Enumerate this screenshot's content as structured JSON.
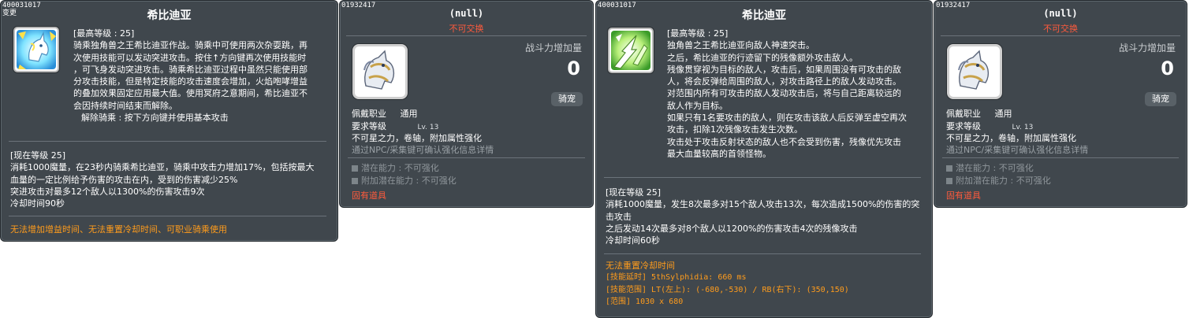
{
  "panels": {
    "skill1": {
      "id": "400031017",
      "sub": "变更",
      "title": "希比迪亚",
      "desc": [
        "[最高等级 : 25]",
        "骑乘独角兽之王希比迪亚作战。骑乘中可使用两次杂耍跳，再",
        "次使用技能可以发动突进攻击。按住↑方向键再次使用技能时",
        "，可飞身发动突进攻击。骑乘希比迪亚过程中虽然只能使用部",
        "分攻击技能，但是特定技能的攻击速度会增加，火焰咆哮增益",
        "的叠加效果固定应用最大值。使用冥府之意期间，希比迪亚不",
        "会因持续时间结束而解除。",
        "解除骑乘 : 按下方向键并使用基本攻击"
      ],
      "level": [
        "[现在等级 25]",
        "消耗1000魔量，在23秒内骑乘希比迪亚，骑乘中攻击力增加17%，包括按最大",
        "血量的一定比例给予伤害的攻击在内，受到的伤害减少25%",
        "突进攻击对最多12个敌人以1300%的伤害攻击9次",
        "冷却时间90秒"
      ],
      "notes": "无法增加增益时间、无法重置冷却时间、可职业骑乘使用"
    },
    "item1": {
      "id": "01932417",
      "title": "(null)",
      "trade": "不可交换",
      "power_label": "战斗力增加量",
      "power_value": "0",
      "badge": "骑宠",
      "job_label": "佩戴职业",
      "job_value": "通用",
      "req_label": "要求等级",
      "req_value": "Lv. 13",
      "upgrade": "不可星之力，卷轴，附加属性强化",
      "npc": "通过NPC/采集键可确认强化信息详情",
      "potential": "潜在能力 : 不可强化",
      "add_potential": "附加潜在能力 : 不可强化",
      "unique": "固有道具"
    },
    "skill2": {
      "id": "400031017",
      "title": "希比迪亚",
      "desc": [
        "[最高等级 : 25]",
        "独角兽之王希比迪亚向敌人神速突击。",
        "之后，希比迪亚的行迹留下的残像额外攻击敌人。",
        "残像贯穿视为目标的敌人，攻击后，如果周围没有可攻击的敌",
        "人，将会反弹给周围的敌人，对攻击路径上的敌人发动攻击。",
        "对范围内所有可攻击的敌人发动攻击后，将与自己距离较远的",
        "敌人作为目标。",
        "如果只有1名要攻击的敌人，则在攻击该敌人后反弹至虚空再次",
        "攻击，扣除1次残像攻击发生次数。",
        "攻击处于攻击反射状态的敌人也不会受到伤害，残像优先攻击",
        "最大血量较高的首领怪物。"
      ],
      "level": [
        "[现在等级 25]",
        "消耗1000魔量，发生8次最多对15个敌人攻击13次，每次造成1500%的伤害的突",
        "击攻击",
        "之后发动14次最多对8个敌人以1200%的伤害攻击4次的残像攻击",
        "冷却时间60秒"
      ],
      "extra": [
        "无法重置冷却时间",
        "[技能延时] 5thSylphidia: 660 ms",
        "[技能范围] LT(左上): (-680,-530) / RB(右下): (350,150)",
        "[范围] 1030 x 680"
      ]
    },
    "item2": {
      "id": "01932417",
      "title": "(null)",
      "trade": "不可交换",
      "power_label": "战斗力增加量",
      "power_value": "0",
      "badge": "骑宠",
      "job_label": "佩戴职业",
      "job_value": "通用",
      "req_label": "要求等级",
      "req_value": "Lv. 13",
      "upgrade": "不可星之力，卷轴，附加属性强化",
      "npc": "通过NPC/采集键可确认强化信息详情",
      "potential": "潜在能力 : 不可强化",
      "add_potential": "附加潜在能力 : 不可强化",
      "unique": "固有道具"
    }
  },
  "colors": {
    "panel_bg": "#40474d",
    "orange": "#ff9c1c",
    "red": "#ff5a3c"
  },
  "icons": {
    "skill1": "unicorn-blue-icon",
    "skill2": "unicorn-green-icon",
    "item": "unicorn-saddle-icon"
  }
}
